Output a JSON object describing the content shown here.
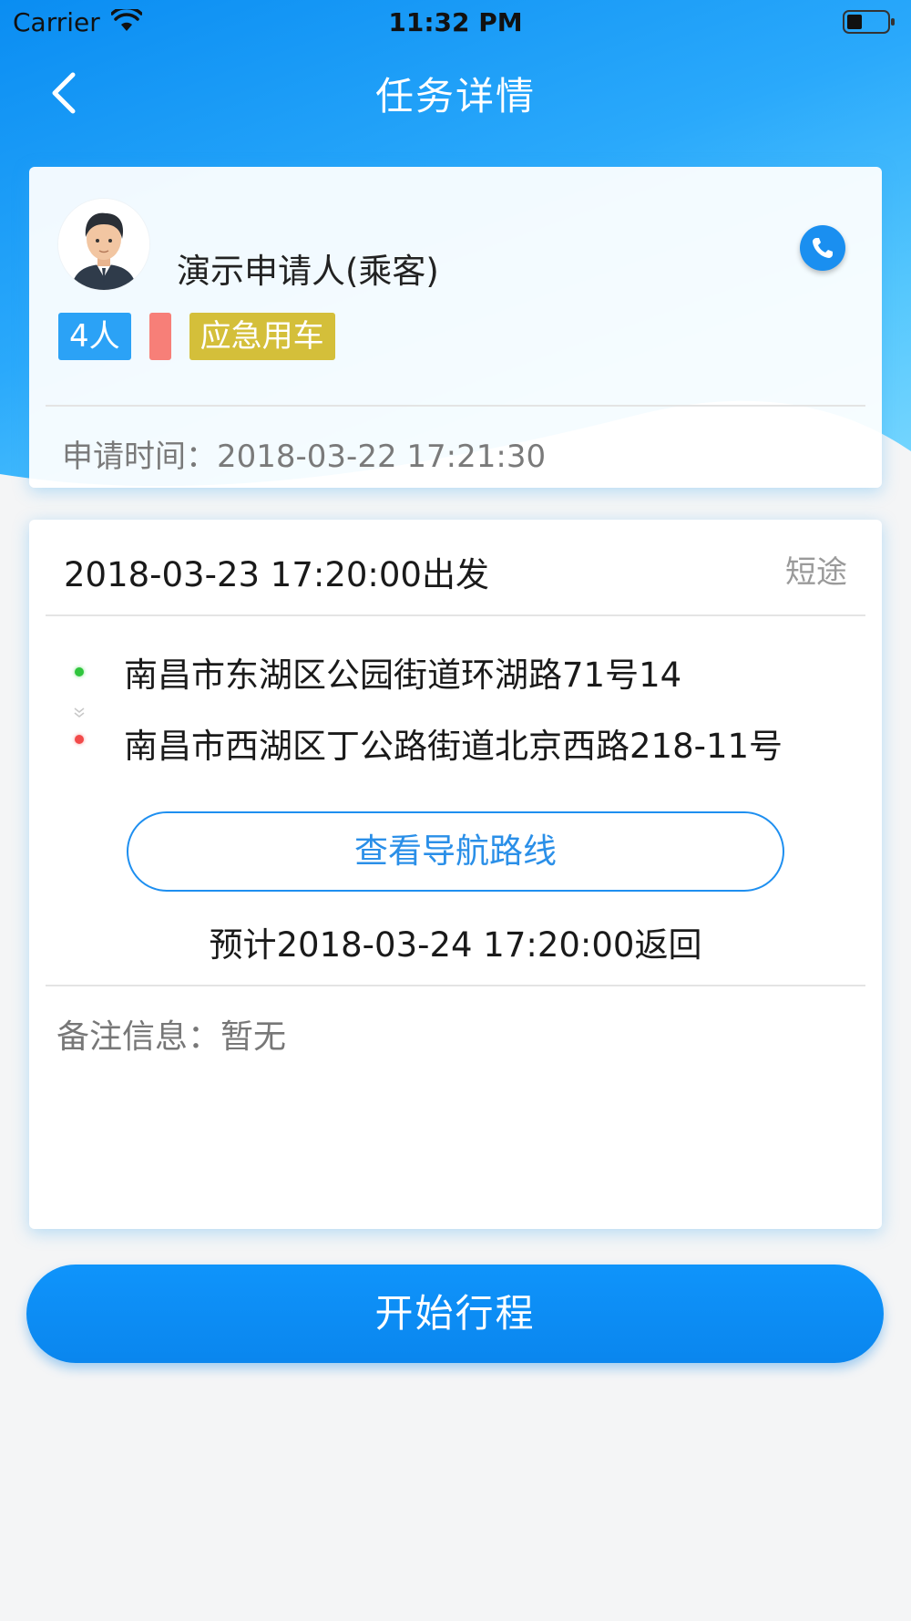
{
  "status_bar": {
    "carrier": "Carrier",
    "time": "11:32 PM"
  },
  "nav": {
    "title": "任务详情",
    "back_icon": "chevron-left-icon"
  },
  "applicant_card": {
    "name": "演示申请人(乘客)",
    "avatar_icon": "person-avatar",
    "phone_icon": "phone-icon",
    "tags": [
      "4人",
      "",
      "应急用车"
    ],
    "apply_time": "申请时间：2018-03-22 17:21:30"
  },
  "trip_card": {
    "departure": "2018-03-23 17:20:00出发",
    "trip_type": "短途",
    "start_address": "南昌市东湖区公园街道环湖路71号14",
    "end_address": "南昌市西湖区丁公路街道北京西路218-11号",
    "nav_button": "查看导航路线",
    "return_time": "预计2018-03-24 17:20:00返回",
    "remark": "备注信息：暂无"
  },
  "start_button": "开始行程",
  "colors": {
    "primary": "#0a8df2",
    "tag_blue": "#2ba2f6",
    "tag_red": "#f77f78",
    "tag_yellow": "#d4bf3a"
  }
}
